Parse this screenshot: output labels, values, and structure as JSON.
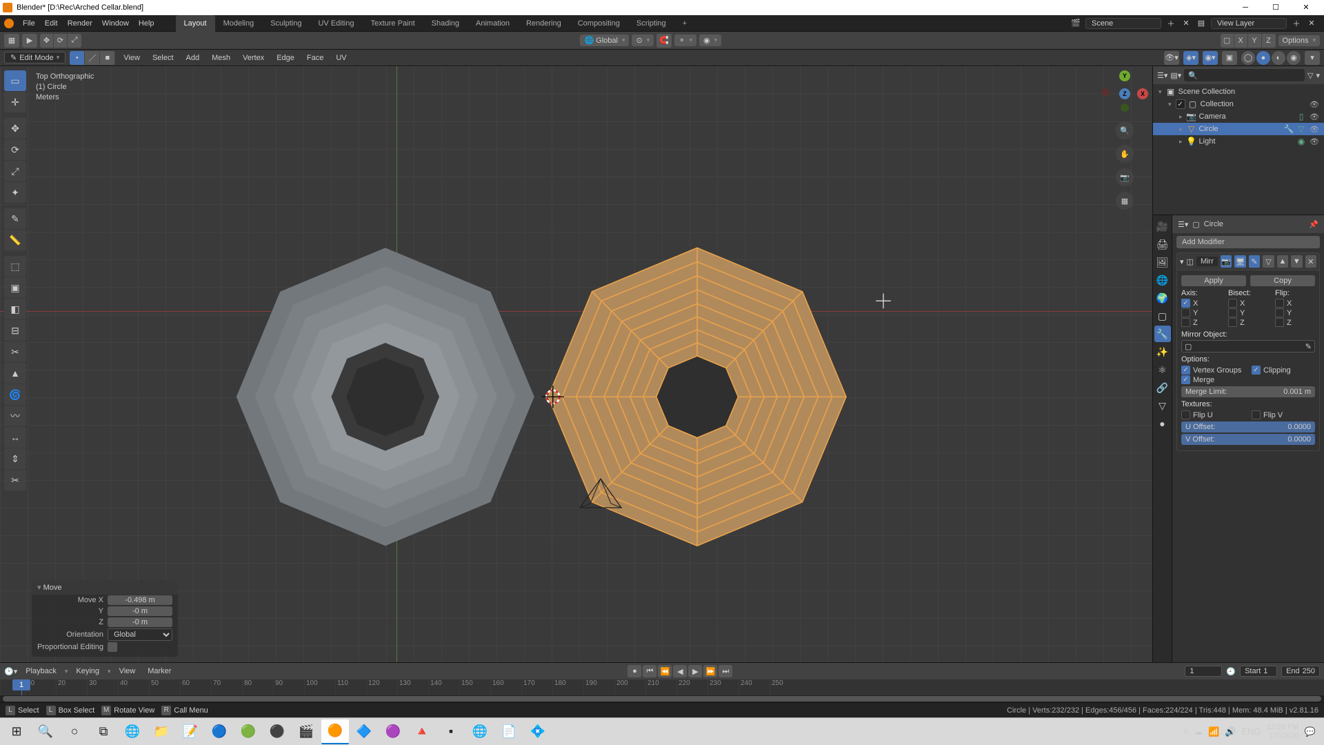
{
  "titlebar": {
    "text": "Blender* [D:\\Rec\\Arched Cellar.blend]"
  },
  "menu": {
    "items": [
      "File",
      "Edit",
      "Render",
      "Window",
      "Help"
    ]
  },
  "workspace_tabs": [
    "Layout",
    "Modeling",
    "Sculpting",
    "UV Editing",
    "Texture Paint",
    "Shading",
    "Animation",
    "Rendering",
    "Compositing",
    "Scripting"
  ],
  "top_right": {
    "scene_label": "Scene",
    "viewlayer_label": "View Layer"
  },
  "viewport_header": {
    "orientation": "Global",
    "snap": "Snapping",
    "options_label": "Options"
  },
  "mode_bar": {
    "mode": "Edit Mode",
    "menus": [
      "View",
      "Select",
      "Add",
      "Mesh",
      "Vertex",
      "Edge",
      "Face",
      "UV"
    ]
  },
  "overlay_info": {
    "line1": "Top Orthographic",
    "line2": "(1) Circle",
    "line3": "Meters"
  },
  "gizmo": {
    "x": "X",
    "y": "Y",
    "z": "Z"
  },
  "operator_panel": {
    "title": "Move",
    "rows": [
      {
        "label": "Move X",
        "value": "-0.498 m"
      },
      {
        "label": "Y",
        "value": "-0 m"
      },
      {
        "label": "Z",
        "value": "-0 m"
      }
    ],
    "orientation_label": "Orientation",
    "orientation_value": "Global",
    "proportional_label": "Proportional Editing"
  },
  "outliner": {
    "scene_collection": "Scene Collection",
    "collection": "Collection",
    "items": [
      {
        "name": "Camera",
        "icon": "camera-icon"
      },
      {
        "name": "Circle",
        "icon": "mesh-icon",
        "selected": true
      },
      {
        "name": "Light",
        "icon": "light-icon"
      }
    ]
  },
  "properties": {
    "context": "Circle",
    "add_modifier": "Add Modifier",
    "modifier": {
      "name": "Mirr",
      "apply": "Apply",
      "copy": "Copy",
      "axis_label": "Axis:",
      "bisect_label": "Bisect:",
      "flip_label": "Flip:",
      "axes": [
        "X",
        "Y",
        "Z"
      ],
      "axis_on": [
        true,
        false,
        false
      ],
      "mirror_object_label": "Mirror Object:",
      "options_label": "Options:",
      "vertex_groups": "Vertex Groups",
      "clipping": "Clipping",
      "merge": "Merge",
      "merge_limit_label": "Merge Limit:",
      "merge_limit_value": "0.001 m",
      "textures_label": "Textures:",
      "flip_u": "Flip U",
      "flip_v": "Flip V",
      "u_offset_label": "U Offset:",
      "u_offset_value": "0.0000",
      "v_offset_label": "V Offset:",
      "v_offset_value": "0.0000"
    }
  },
  "timeline": {
    "menus": [
      "Playback",
      "Keying",
      "View",
      "Marker"
    ],
    "current": "1",
    "start_label": "Start",
    "start": "1",
    "end_label": "End",
    "end": "250",
    "ticks": [
      "10",
      "20",
      "30",
      "40",
      "50",
      "60",
      "70",
      "80",
      "90",
      "100",
      "110",
      "120",
      "130",
      "140",
      "150",
      "160",
      "170",
      "180",
      "190",
      "200",
      "210",
      "220",
      "230",
      "240",
      "250"
    ]
  },
  "statusbar": {
    "select": "Select",
    "box_select": "Box Select",
    "rotate_view": "Rotate View",
    "call_menu": "Call Menu",
    "stats": "Circle | Verts:232/232 | Edges:456/456 | Faces:224/224 | Tris:448 | Mem: 48.4 MiB | v2.81.16"
  },
  "win": {
    "tray": {
      "lang": "ENG",
      "time": "12:09 PM",
      "date": "1/7/2020"
    }
  },
  "colors": {
    "accent": "#4772b3",
    "orange": "#e87d0d"
  }
}
